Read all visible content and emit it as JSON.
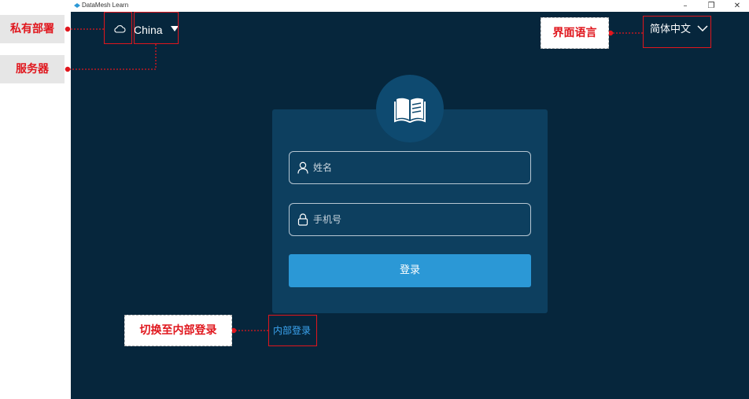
{
  "window": {
    "title": "DataMesh Learn",
    "minimize_glyph": "–",
    "restore_glyph": "❐",
    "close_glyph": "✕"
  },
  "header": {
    "server_name": "China",
    "language": "简体中文"
  },
  "login": {
    "name_placeholder": "姓名",
    "phone_placeholder": "手机号",
    "login_label": "登录",
    "internal_login_link": "内部登录"
  },
  "annotations": {
    "private_deploy": "私有部署",
    "server": "服务器",
    "ui_language": "界面语言",
    "switch_internal": "切换至内部登录"
  },
  "icons": {
    "deployment": "cloud-icon",
    "server_dropdown": "caret-down-icon",
    "language_dropdown": "chevron-down-icon",
    "brand": "open-book-icon",
    "name_field": "user-icon",
    "phone_field": "lock-icon"
  },
  "colors": {
    "background": "#06263c",
    "card": "#0d3f5f",
    "button": "#2b98d6",
    "link": "#3ca4f0",
    "annotation": "#e0161d"
  }
}
